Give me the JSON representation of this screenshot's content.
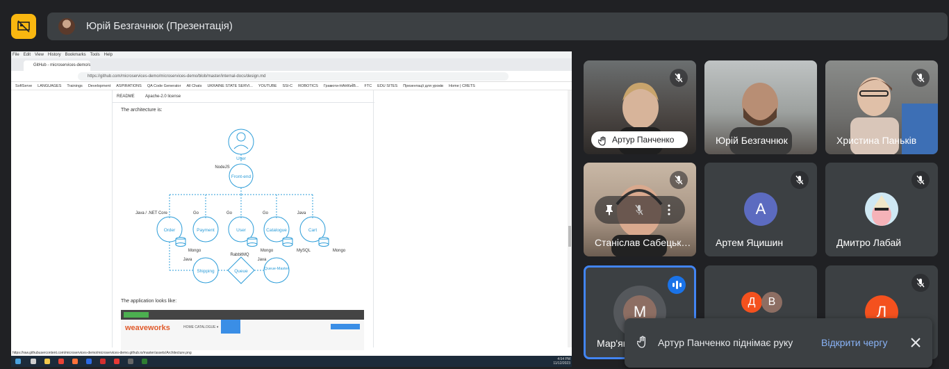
{
  "meeting": {
    "presenter_label": "Юрій Безгачнюк (Презентація)"
  },
  "browser": {
    "menu": [
      "File",
      "Edit",
      "View",
      "History",
      "Bookmarks",
      "Tools",
      "Help"
    ],
    "tab_title": "GitHub - microservices-demo/s...",
    "url": "https://github.com/microservices-demo/microservices-demo/blob/master/internal-docs/design.md",
    "bookmarks": [
      "SoftServe",
      "LANGUAGES",
      "Trainings",
      "Development",
      "ASPIRATIONS",
      "QA Code Generator",
      "All Chats",
      "UKRAINE STATE SERVI...",
      "YOUTUBE",
      "SSI-C",
      "ROBOTICS",
      "Грамоти-НАНКиЇВ...",
      "FTC",
      "EDU SITES",
      "Презентації для уроків",
      "Home | CRETS"
    ],
    "readme_tabs": [
      "README",
      "Apache-2.0 license"
    ],
    "architecture_label": "The architecture is:",
    "looks_like_label": "The application looks like:",
    "status_url": "https://raw.githubusercontent.com/microservices-demo/microservices-demo.github.io/master/assets/Architecture.png",
    "clock_time": "4:54 PM",
    "clock_date": "11/12/2023"
  },
  "diagram": {
    "user_top": "User",
    "nodejs": "NodeJS",
    "frontend": "Front-end",
    "services": [
      {
        "name": "Order",
        "lang": "Java / .NET Core",
        "db": "Mongo"
      },
      {
        "name": "Payment",
        "lang": "Go",
        "db": ""
      },
      {
        "name": "User",
        "lang": "Go",
        "db": "Mongo"
      },
      {
        "name": "Catalogue",
        "lang": "Go",
        "db": "MySQL"
      },
      {
        "name": "Cart",
        "lang": "Java",
        "db": "Mongo"
      }
    ],
    "shipping": "Shipping",
    "shipping_lang": "Java",
    "queue": "Queue",
    "rabbitmq": "RabbitMQ",
    "queue_master": "Queue-Master",
    "queue_master_lang": "Java"
  },
  "weave": {
    "logo": "weaveworks",
    "sublogo": "socks",
    "nav": "HOME   CATALOGUE ▾",
    "account": "ACCOUNT"
  },
  "participants": [
    {
      "name": "Артур Панченко",
      "hand_raised": true,
      "muted": true
    },
    {
      "name": "Юрій Безгачнюк",
      "muted": false
    },
    {
      "name": "Христина Паньків",
      "muted": true
    },
    {
      "name": "Станіслав Сабецький",
      "muted": true
    },
    {
      "name": "Артем Яцишин",
      "initial": "А",
      "muted": true,
      "color": "#5c6bc0"
    },
    {
      "name": "Дмитро Лабай",
      "muted": true
    },
    {
      "name": "Мар'яна",
      "initial": "М",
      "speaking": true,
      "color": "#8d6e63"
    },
    {
      "name": "",
      "initials": [
        "Д",
        "В"
      ]
    },
    {
      "name": "",
      "initial": "Л",
      "muted": true,
      "color": "#f4511e"
    }
  ],
  "toast": {
    "message": "Артур Панченко піднімає руку",
    "action": "Відкрити чергу"
  },
  "colors": {
    "accent": "#1a73e8",
    "link": "#8ab4f8",
    "logo_bg": "#f9b710"
  }
}
